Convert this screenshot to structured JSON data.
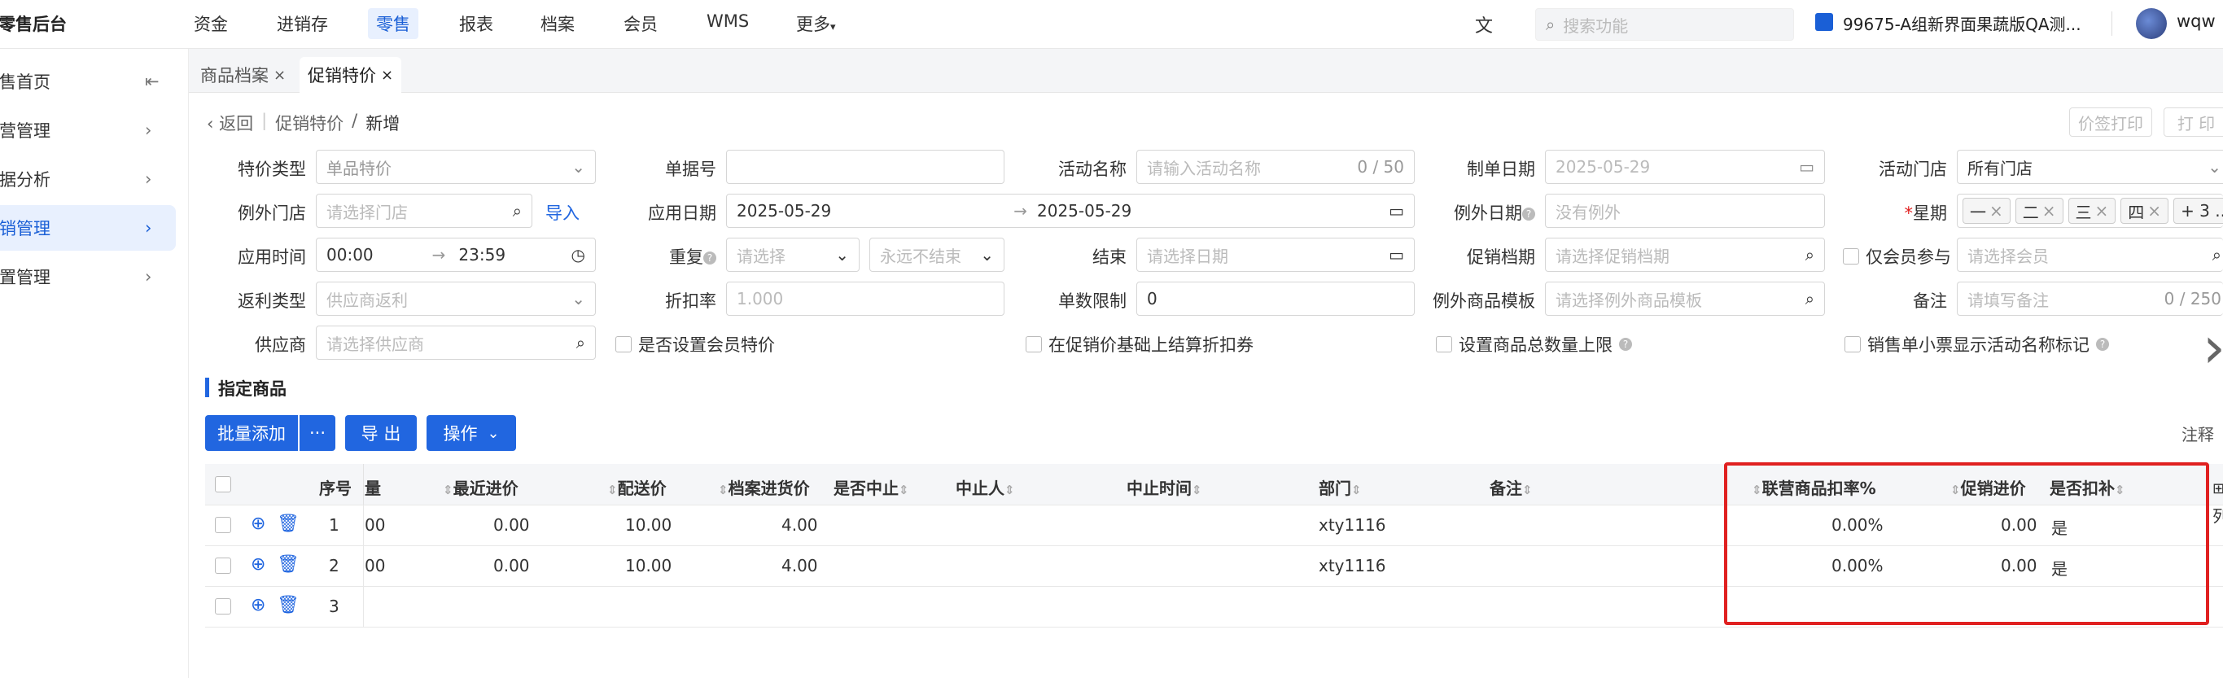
{
  "app": {
    "title": "零售后台"
  },
  "nav": {
    "items": [
      "资金",
      "进销存",
      "零售",
      "报表",
      "档案",
      "会员",
      "WMS",
      "更多"
    ],
    "active": "零售"
  },
  "topbar": {
    "search_placeholder": "搜索功能",
    "store_name": "99675-A组新界面果蔬版QA测...",
    "user": "wqw",
    "translate_glyph": "文"
  },
  "sidebar": {
    "items": [
      "零售首页",
      "运营管理",
      "数据分析",
      "促销管理",
      "设置管理"
    ],
    "active_index": 3
  },
  "tabs": [
    {
      "label": "商品档案"
    },
    {
      "label": "促销特价"
    }
  ],
  "breadcrumb": {
    "back": "返回",
    "parent": "促销特价",
    "current": "新增"
  },
  "actions": {
    "price_tag_print": "价签打印",
    "print": "打 印"
  },
  "form": {
    "special_type_label": "特价类型",
    "special_type_value": "单品特价",
    "bill_no_label": "单据号",
    "activity_name_label": "活动名称",
    "activity_name_placeholder": "请输入活动名称",
    "activity_name_count": "0 / 50",
    "bill_date_label": "制单日期",
    "bill_date_value": "2025-05-29",
    "activity_store_label": "活动门店",
    "activity_store_value": "所有门店",
    "exclude_store_label": "例外门店",
    "exclude_store_placeholder": "请选择门店",
    "import_link": "导入",
    "apply_date_label": "应用日期",
    "apply_date_start": "2025-05-29",
    "apply_date_end": "2025-05-29",
    "exclude_date_label": "例外日期",
    "exclude_date_placeholder": "没有例外",
    "week_label": "星期",
    "week_tags": [
      "一",
      "二",
      "三",
      "四"
    ],
    "week_more": "+ 3 ...",
    "apply_time_label": "应用时间",
    "apply_time_start": "00:00",
    "apply_time_end": "23:59",
    "repeat_label": "重复",
    "repeat_placeholder": "请选择",
    "repeat_end": "永远不结束",
    "end_label": "结束",
    "end_placeholder": "请选择日期",
    "promo_file_label": "促销档期",
    "promo_file_placeholder": "请选择促销档期",
    "member_only_label": "仅会员参与",
    "member_placeholder": "请选择会员",
    "rebate_type_label": "返利类型",
    "rebate_type_placeholder": "供应商返利",
    "discount_label": "折扣率",
    "discount_placeholder": "1.000",
    "qty_limit_label": "单数限制",
    "qty_limit_value": "0",
    "exclude_template_label": "例外商品模板",
    "exclude_template_placeholder": "请选择例外商品模板",
    "remark_label": "备注",
    "remark_placeholder": "请填写备注",
    "remark_count": "0 / 250",
    "supplier_label": "供应商",
    "supplier_placeholder": "请选择供应商",
    "cb_member_special": "是否设置会员特价",
    "cb_calc_discount": "在促销价基础上结算折扣券",
    "cb_total_limit": "设置商品总数量上限",
    "cb_receipt_mark": "销售单小票显示活动名称标记"
  },
  "section": {
    "title": "指定商品",
    "note": "注释"
  },
  "toolbar": {
    "batch_add": "批量添加",
    "more": "···",
    "export": "导 出",
    "operation": "操作"
  },
  "table": {
    "headers": [
      "序号",
      "量",
      "最近进价",
      "配送价",
      "档案进货价",
      "是否中止",
      "中止人",
      "中止时间",
      "部门",
      "备注",
      "联营商品扣率%",
      "促销进价",
      "是否扣补"
    ],
    "rows": [
      {
        "no": "1",
        "qty": "00",
        "recent_price": "0.00",
        "delivery_price": "10.00",
        "file_price": "4.00",
        "dept": "xty1116",
        "rate": "0.00%",
        "promo_price": "0.00",
        "deduct": "是"
      },
      {
        "no": "2",
        "qty": "00",
        "recent_price": "0.00",
        "delivery_price": "10.00",
        "file_price": "4.00",
        "dept": "xty1116",
        "rate": "0.00%",
        "promo_price": "0.00",
        "deduct": "是"
      },
      {
        "no": "3"
      }
    ],
    "edge_text": "列"
  },
  "colors": {
    "accent": "#2166e0",
    "highlight": "#e02020"
  }
}
